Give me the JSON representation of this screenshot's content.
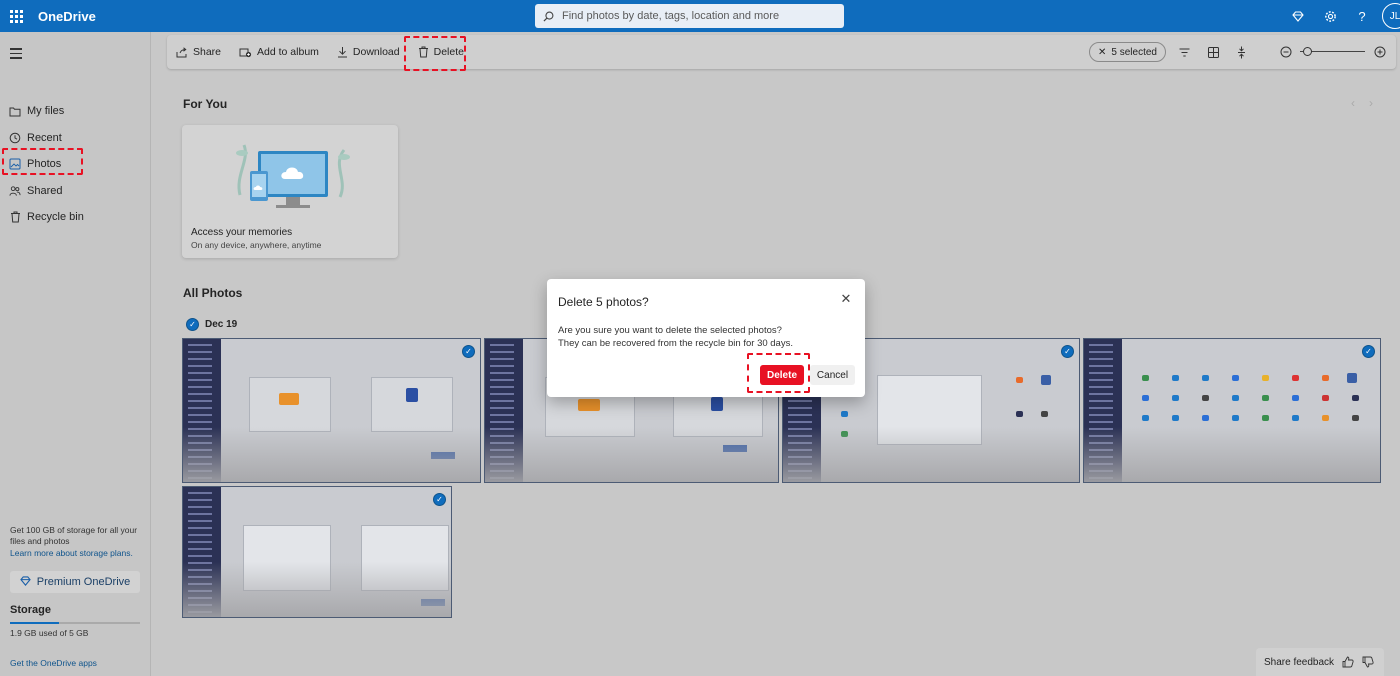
{
  "app": {
    "title": "OneDrive",
    "avatar_initials": "JL"
  },
  "search": {
    "placeholder": "Find photos by date, tags, location and more"
  },
  "header_icons": [
    "diamond-icon",
    "gear-icon",
    "help-icon"
  ],
  "sidebar": {
    "items": [
      {
        "label": "My files",
        "icon": "folder-icon"
      },
      {
        "label": "Recent",
        "icon": "clock-icon"
      },
      {
        "label": "Photos",
        "icon": "image-icon",
        "active": true
      },
      {
        "label": "Shared",
        "icon": "people-icon"
      },
      {
        "label": "Recycle bin",
        "icon": "trash-icon"
      }
    ],
    "promo_text": "Get 100 GB of storage for all your files and photos",
    "promo_link": "Learn more about storage plans.",
    "premium_button": "Premium OneDrive",
    "storage_label": "Storage",
    "storage_used_text": "1.9 GB used of 5 GB",
    "storage_used_fraction": 0.38,
    "get_apps": "Get the OneDrive apps"
  },
  "toolbar": {
    "share": "Share",
    "add_to_album": "Add to album",
    "download": "Download",
    "delete": "Delete",
    "selected": "5 selected"
  },
  "for_you": {
    "title": "For You",
    "card_title": "Access your memories",
    "card_subtitle": "On any device, anywhere, anytime"
  },
  "all_photos": {
    "title": "All Photos",
    "group_date": "Dec 19",
    "photo_count": 5
  },
  "dialog": {
    "title": "Delete 5 photos?",
    "body_line1": "Are you sure you want to delete the selected photos?",
    "body_line2": "They can be recovered from the recycle bin for 30 days.",
    "delete": "Delete",
    "cancel": "Cancel"
  },
  "feedback": {
    "label": "Share feedback"
  },
  "colors": {
    "brand": "#0f6cbd",
    "danger": "#e81123",
    "highlight": "#e81123"
  }
}
